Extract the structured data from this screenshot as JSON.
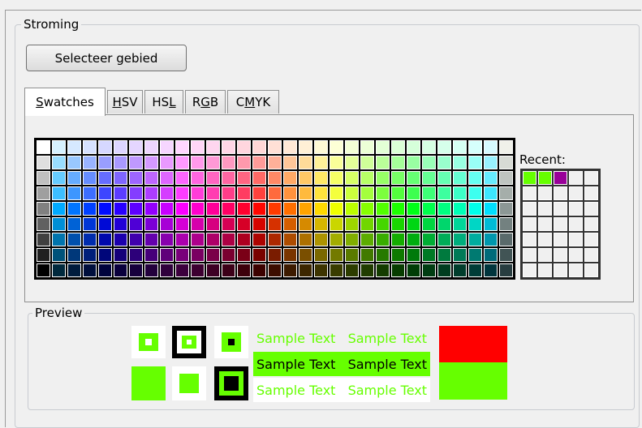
{
  "group": {
    "title": "Stroming"
  },
  "select_area_button": "Selecteer gebied",
  "tabs": [
    {
      "label": "Swatches",
      "active": true
    },
    {
      "label": "HSV",
      "active": false
    },
    {
      "label": "HSL",
      "active": false
    },
    {
      "label": "RGB",
      "active": false
    },
    {
      "label": "CMYK",
      "active": false
    }
  ],
  "recent": {
    "label": "Recent:",
    "colors": [
      "#66ff00",
      "#66ff00",
      "#990099"
    ]
  },
  "preview": {
    "title": "Preview",
    "sample_text": "Sample Text",
    "foreground_color": "#66ff00",
    "previous_color": "#ff0000",
    "new_color": "#66ff00"
  },
  "colors": {
    "accent_green": "#66ff00",
    "accent_red": "#ff0000"
  }
}
